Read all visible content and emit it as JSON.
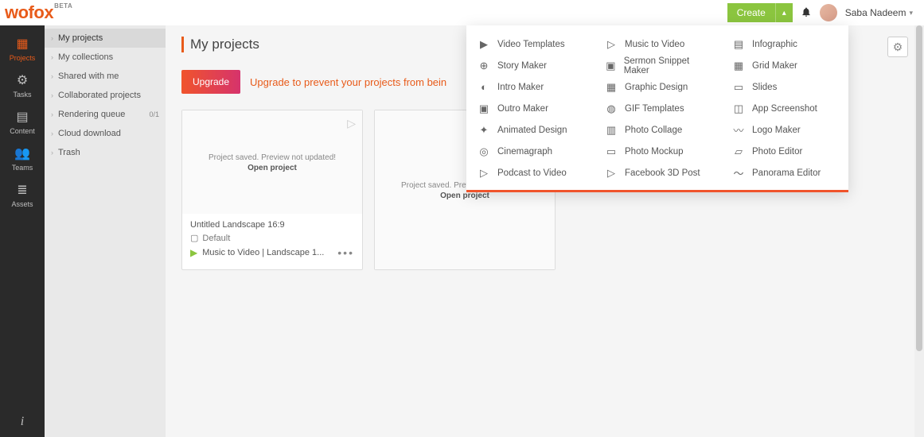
{
  "brand": {
    "name": "wofox",
    "tag": "BETA"
  },
  "top": {
    "create_label": "Create",
    "username": "Saba Nadeem"
  },
  "rail": {
    "projects": "Projects",
    "tasks": "Tasks",
    "content": "Content",
    "teams": "Teams",
    "assets": "Assets"
  },
  "sidebar": {
    "my_projects": "My projects",
    "my_collections": "My collections",
    "shared": "Shared with me",
    "collab": "Collaborated projects",
    "rendering": "Rendering queue",
    "rendering_badge": "0/1",
    "cloud": "Cloud download",
    "trash": "Trash"
  },
  "content": {
    "title": "My projects",
    "upgrade_btn": "Upgrade",
    "upgrade_msg": "Upgrade to prevent your projects from bein",
    "card1": {
      "saved_msg": "Project saved. Preview not updated!",
      "open": "Open project",
      "title": "Untitled Landscape 16:9",
      "folder": "Default",
      "subtitle": "Music to Video | Landscape 1..."
    },
    "card2": {
      "saved_msg": "Project saved. Preview not updated!",
      "open": "Open project"
    }
  },
  "mega": {
    "col1": [
      "Video Templates",
      "Story Maker",
      "Intro Maker",
      "Outro Maker",
      "Animated Design",
      "Cinemagraph",
      "Podcast to Video"
    ],
    "col2": [
      "Music to Video",
      "Sermon Snippet Maker",
      "Graphic Design",
      "GIF Templates",
      "Photo Collage",
      "Photo Mockup",
      "Facebook 3D Post"
    ],
    "col3": [
      "Infographic",
      "Grid Maker",
      "Slides",
      "App Screenshot",
      "Logo Maker",
      "Photo Editor",
      "Panorama Editor"
    ]
  }
}
